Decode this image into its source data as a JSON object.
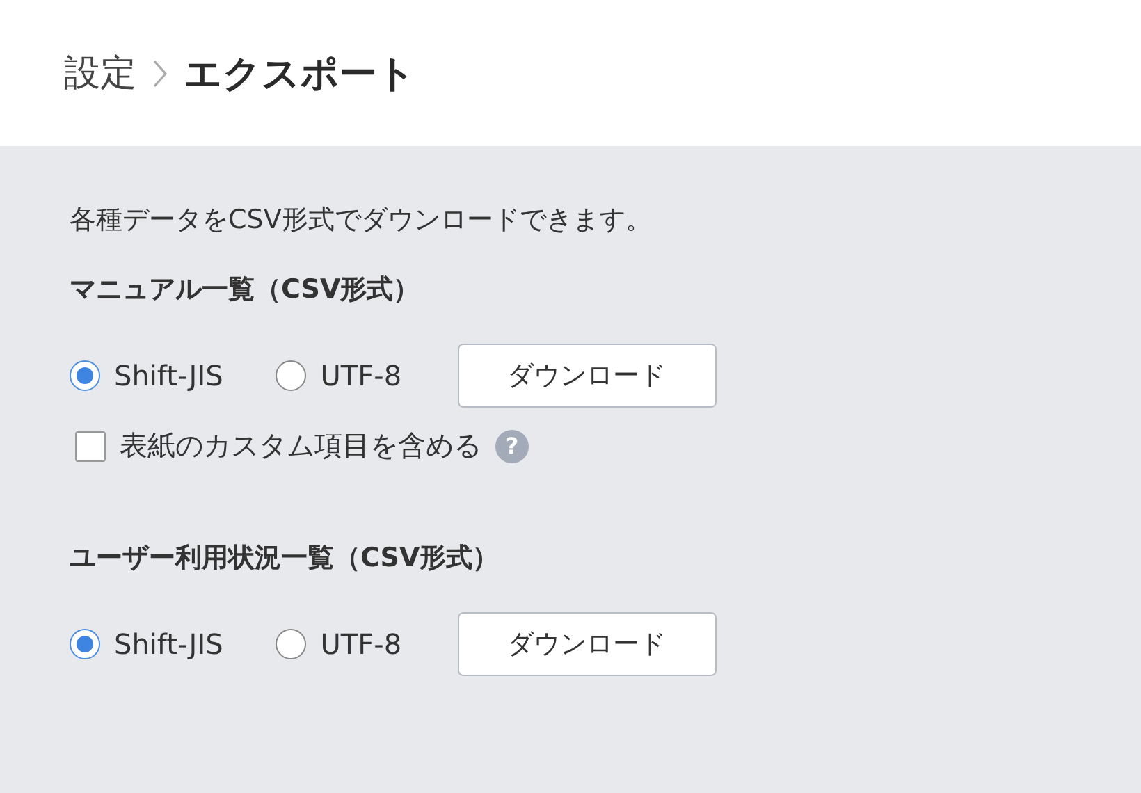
{
  "breadcrumb": [
    {
      "label": "設定"
    },
    {
      "label": "エクスポート"
    }
  ],
  "intro": "各種データをCSV形式でダウンロードできます。",
  "sections": [
    {
      "title": "マニュアル一覧（CSV形式）",
      "encodings": [
        {
          "label": "Shift-JIS",
          "selected": true
        },
        {
          "label": "UTF-8",
          "selected": false
        }
      ],
      "button": "ダウンロード",
      "option": {
        "label": "表紙のカスタム項目を含める",
        "checked": false,
        "help": "?"
      }
    },
    {
      "title": "ユーザー利用状況一覧（CSV形式）",
      "encodings": [
        {
          "label": "Shift-JIS",
          "selected": true
        },
        {
          "label": "UTF-8",
          "selected": false
        }
      ],
      "button": "ダウンロード"
    }
  ]
}
